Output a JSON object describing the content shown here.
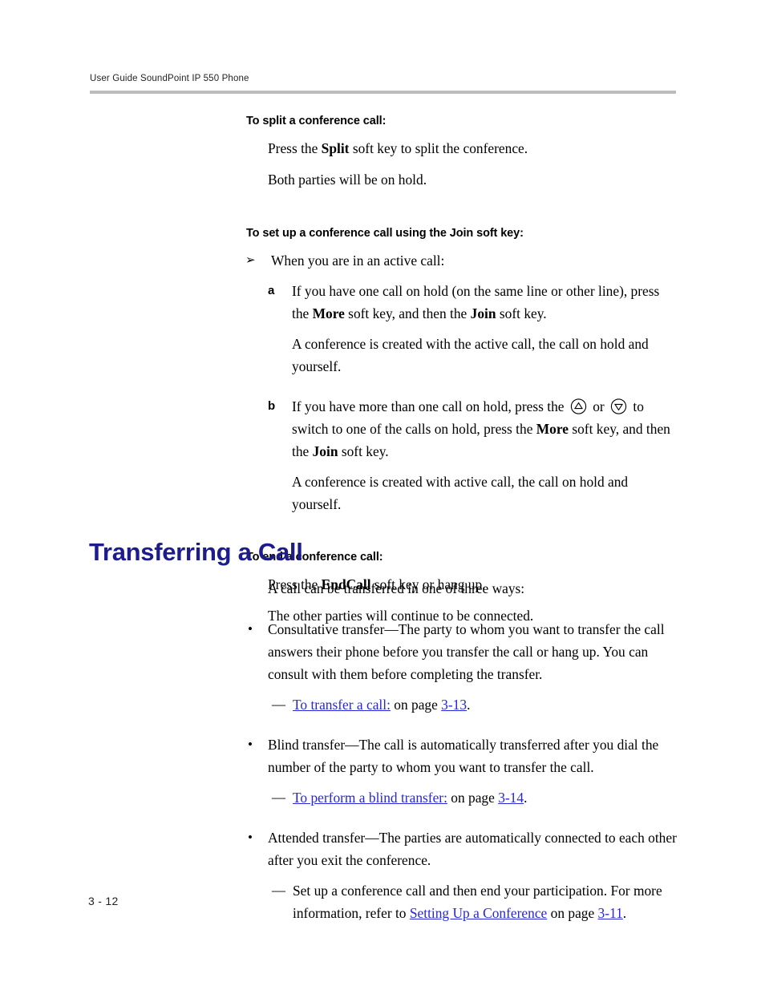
{
  "header": {
    "running_title": "User Guide SoundPoint IP 550 Phone"
  },
  "sections": [
    {
      "heading": "To split a conference call:",
      "line1_a": "Press the ",
      "line1_b": "Split",
      "line1_c": " soft key to split the conference.",
      "line2": "Both parties will be on hold."
    },
    {
      "heading": "To set up a conference call using the Join soft key:",
      "arrow_marker": "➢",
      "intro": "When you are in an active call:",
      "steps": [
        {
          "marker": "a",
          "text_1": "If you have one call on hold (on the same line or other line), press the ",
          "bold_1": "More",
          "text_2": " soft key, and then the ",
          "bold_2": "Join",
          "text_3": " soft key.",
          "result": "A conference is created with the active call, the call on hold and yourself."
        },
        {
          "marker": "b",
          "text_1": "If you have more than one call on hold, press the ",
          "icon_up": "up-arrow-key-icon",
          "or_word": " or ",
          "icon_down": "down-arrow-key-icon",
          "text_2": " to switch to one of the calls on hold, press the ",
          "bold_1": "More",
          "text_3": " soft key, and then the ",
          "bold_2": "Join",
          "text_4": " soft key.",
          "result": "A conference is created with active call, the call on hold and yourself."
        }
      ]
    },
    {
      "heading": "To end a conference call:",
      "line1_a": "Press the ",
      "line1_b": "EndCall",
      "line1_c": " soft key or hang up.",
      "line2": "The other parties will continue to be connected."
    }
  ],
  "chapter": {
    "title": "Transferring a Call",
    "intro": "A call can be transferred in one of three ways:",
    "bullet_marker": "•",
    "dash_marker": "—",
    "items": [
      {
        "body": "Consultative transfer—The party to whom you want to transfer the call answers their phone before you transfer the call or hang up. You can consult with them before completing the transfer.",
        "sub": {
          "link_text": "To transfer a call:",
          "mid_text": " on page ",
          "page_link": "3-13",
          "end_text": "."
        }
      },
      {
        "body": "Blind transfer—The call is automatically transferred after you dial the number of the party to whom you want to transfer the call.",
        "sub": {
          "link_text": "To perform a blind transfer:",
          "mid_text": " on page ",
          "page_link": "3-14",
          "end_text": "."
        }
      },
      {
        "body": "Attended transfer—The parties are automatically connected to each other after you exit the conference.",
        "sub": {
          "pre_text": "Set up a conference call and then end your participation. For more information, refer to ",
          "link_text": "Setting Up a Conference",
          "mid_text": " on page ",
          "page_link": "3-11",
          "end_text": "."
        }
      }
    ]
  },
  "footer": {
    "page_number": "3 - 12"
  },
  "colors": {
    "heading_blue": "#1c1c8c",
    "link_blue": "#2727d8",
    "rule_gray": "#bcbcbc"
  }
}
